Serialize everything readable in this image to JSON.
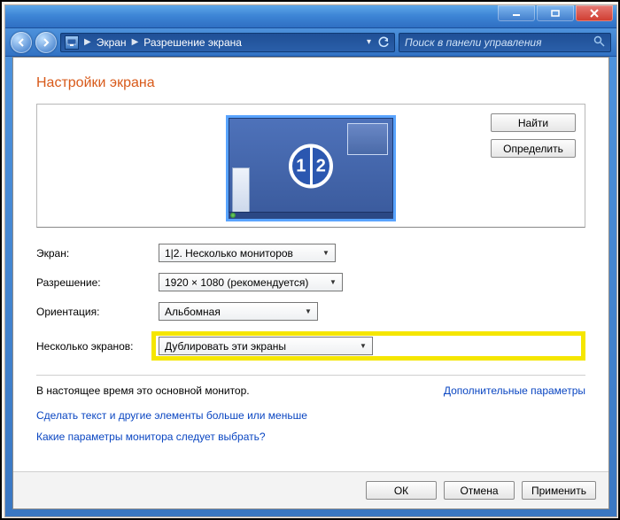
{
  "titlebar": {
    "minimize_tooltip": "Minimize",
    "maximize_tooltip": "Maximize",
    "close_tooltip": "Close"
  },
  "breadcrumb": {
    "level1": "Экран",
    "level2": "Разрешение экрана"
  },
  "search": {
    "placeholder": "Поиск в панели управления"
  },
  "page": {
    "title": "Настройки экрана"
  },
  "preview": {
    "badge_left": "1",
    "badge_right": "2",
    "find_btn": "Найти",
    "detect_btn": "Определить"
  },
  "form": {
    "display_label": "Экран:",
    "display_value": "1|2. Несколько мониторов",
    "resolution_label": "Разрешение:",
    "resolution_value": "1920 × 1080 (рекомендуется)",
    "orientation_label": "Ориентация:",
    "orientation_value": "Альбомная",
    "multi_label": "Несколько экранов:",
    "multi_value": "Дублировать эти экраны"
  },
  "status": {
    "primary_text": "В настоящее время это основной монитор.",
    "advanced_link": "Дополнительные параметры"
  },
  "links": {
    "text_size": "Сделать текст и другие элементы больше или меньше",
    "which_monitor": "Какие параметры монитора следует выбрать?"
  },
  "footer": {
    "ok": "ОК",
    "cancel": "Отмена",
    "apply": "Применить"
  }
}
